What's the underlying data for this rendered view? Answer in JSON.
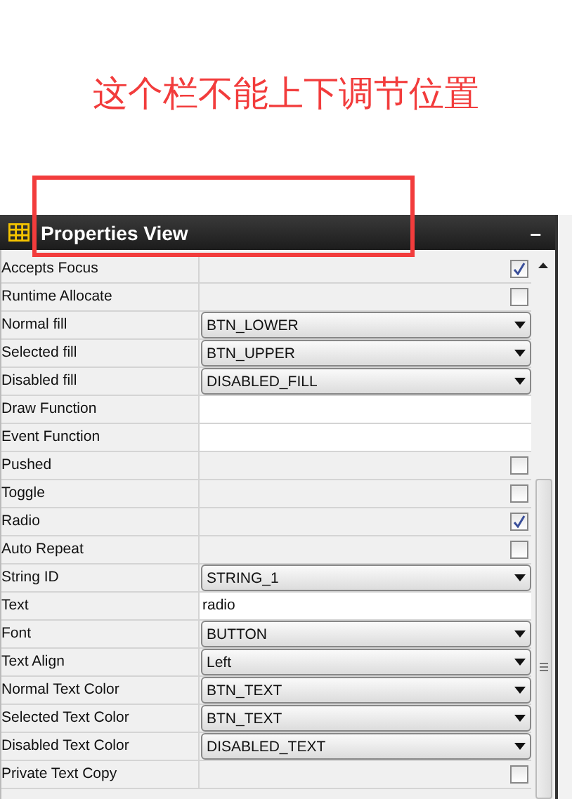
{
  "annotation": {
    "text": "这个栏不能上下调节位置"
  },
  "panel": {
    "title": "Properties View",
    "collapse_button": "–"
  },
  "properties": [
    {
      "kind": "checkbox",
      "label": "Accepts Focus",
      "checked": true
    },
    {
      "kind": "checkbox",
      "label": "Runtime Allocate",
      "checked": false
    },
    {
      "kind": "dropdown",
      "label": "Normal fill",
      "value": "BTN_LOWER"
    },
    {
      "kind": "dropdown",
      "label": "Selected fill",
      "value": "BTN_UPPER"
    },
    {
      "kind": "dropdown",
      "label": "Disabled fill",
      "value": "DISABLED_FILL"
    },
    {
      "kind": "text",
      "label": "Draw Function"
    },
    {
      "kind": "text",
      "label": "Event Function"
    },
    {
      "kind": "checkbox",
      "label": "Pushed",
      "checked": false
    },
    {
      "kind": "checkbox",
      "label": "Toggle",
      "checked": false
    },
    {
      "kind": "checkbox",
      "label": "Radio",
      "checked": true
    },
    {
      "kind": "checkbox",
      "label": "Auto Repeat",
      "checked": false
    },
    {
      "kind": "dropdown",
      "label": "String ID",
      "value": "STRING_1"
    },
    {
      "kind": "text",
      "label": "Text",
      "value": "radio"
    },
    {
      "kind": "dropdown",
      "label": "Font",
      "value": "BUTTON"
    },
    {
      "kind": "dropdown",
      "label": "Text Align",
      "value": "Left"
    },
    {
      "kind": "dropdown",
      "label": "Normal Text Color",
      "value": "BTN_TEXT"
    },
    {
      "kind": "dropdown",
      "label": "Selected Text Color",
      "value": "BTN_TEXT"
    },
    {
      "kind": "dropdown",
      "label": "Disabled Text Color",
      "value": "DISABLED_TEXT"
    },
    {
      "kind": "checkbox",
      "label": "Private Text Copy",
      "checked": false
    }
  ]
}
